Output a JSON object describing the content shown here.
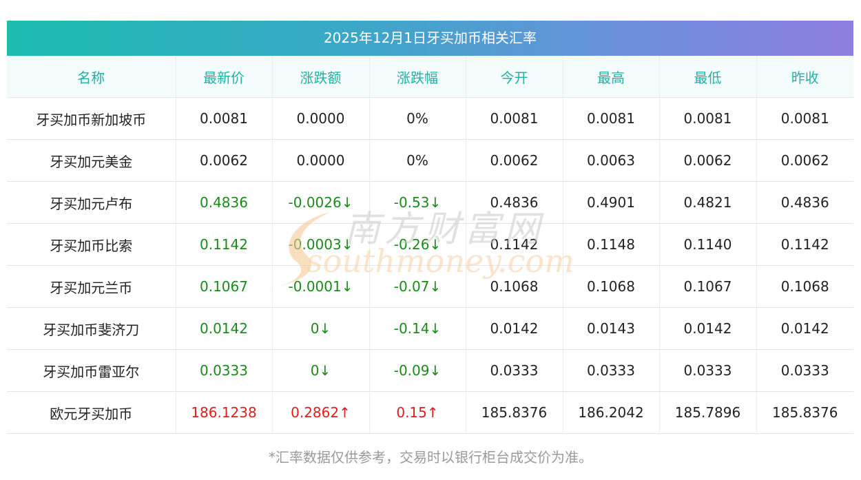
{
  "title": "2025年12月1日牙买加币相关汇率",
  "headers": [
    "名称",
    "最新价",
    "涨跌额",
    "涨跌幅",
    "今开",
    "最高",
    "最低",
    "昨收"
  ],
  "rows": [
    {
      "name": "牙买加币新加坡币",
      "latest": "0.0081",
      "change": "0.0000",
      "pct": "0%",
      "open": "0.0081",
      "high": "0.0081",
      "low": "0.0081",
      "prev": "0.0081",
      "trend": "flat"
    },
    {
      "name": "牙买加元美金",
      "latest": "0.0062",
      "change": "0.0000",
      "pct": "0%",
      "open": "0.0062",
      "high": "0.0063",
      "low": "0.0062",
      "prev": "0.0062",
      "trend": "flat"
    },
    {
      "name": "牙买加元卢布",
      "latest": "0.4836",
      "change": "-0.0026↓",
      "pct": "-0.53↓",
      "open": "0.4836",
      "high": "0.4901",
      "low": "0.4821",
      "prev": "0.4836",
      "trend": "down"
    },
    {
      "name": "牙买加币比索",
      "latest": "0.1142",
      "change": "-0.0003↓",
      "pct": "-0.26↓",
      "open": "0.1142",
      "high": "0.1148",
      "low": "0.1140",
      "prev": "0.1142",
      "trend": "down"
    },
    {
      "name": "牙买加元兰币",
      "latest": "0.1067",
      "change": "-0.0001↓",
      "pct": "-0.07↓",
      "open": "0.1068",
      "high": "0.1068",
      "low": "0.1067",
      "prev": "0.1068",
      "trend": "down"
    },
    {
      "name": "牙买加币斐济刀",
      "latest": "0.0142",
      "change": "0↓",
      "pct": "-0.14↓",
      "open": "0.0142",
      "high": "0.0143",
      "low": "0.0142",
      "prev": "0.0142",
      "trend": "down"
    },
    {
      "name": "牙买加币雷亚尔",
      "latest": "0.0333",
      "change": "0↓",
      "pct": "-0.09↓",
      "open": "0.0333",
      "high": "0.0333",
      "low": "0.0333",
      "prev": "0.0333",
      "trend": "down"
    },
    {
      "name": "欧元牙买加币",
      "latest": "186.1238",
      "change": "0.2862↑",
      "pct": "0.15↑",
      "open": "185.8376",
      "high": "186.2042",
      "low": "185.7896",
      "prev": "185.8376",
      "trend": "up"
    }
  ],
  "note": "*汇率数据仅供参考，交易时以银行柜台成交价为准。",
  "watermark": {
    "cn": "南方财富网",
    "en": "southmoney.com"
  },
  "colors": {
    "header_text": "#1fb3a6",
    "up": "#e21c1c",
    "down": "#1a8a1a",
    "gradient_start": "#1cbcb0",
    "gradient_end": "#8e7ee0"
  }
}
